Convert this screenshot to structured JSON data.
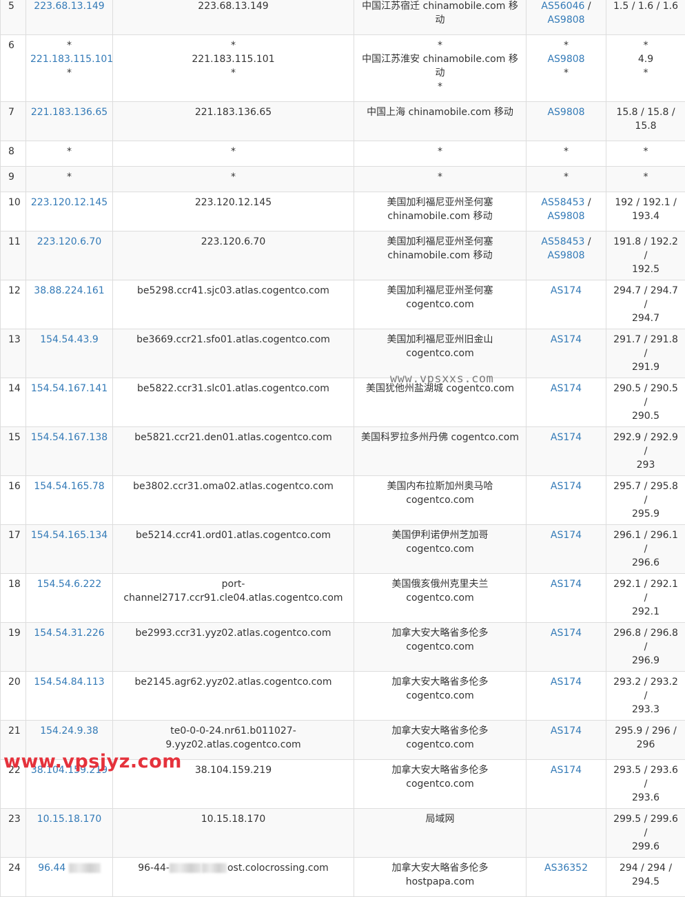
{
  "rows": [
    {
      "hop": "5",
      "ip": "223.68.13.149",
      "host": [
        "223.68.13.149"
      ],
      "loc": [
        "中国江苏宿迁 chinamobile.com 移",
        "动"
      ],
      "asn": [
        [
          "AS56046",
          " /"
        ],
        [
          "AS9808",
          ""
        ]
      ],
      "rtt": [
        "1.5 / 1.6 / 1.6"
      ]
    },
    {
      "hop": "6",
      "ip": [
        "*",
        "221.183.115.101",
        "*"
      ],
      "host": [
        "*",
        "221.183.115.101",
        "*"
      ],
      "loc": [
        "*",
        "中国江苏淮安 chinamobile.com 移",
        "动",
        "*"
      ],
      "asn": [
        [
          "*",
          ""
        ],
        [
          "AS9808",
          ""
        ],
        [
          "*",
          ""
        ]
      ],
      "rtt": [
        "*",
        "4.9",
        "*"
      ]
    },
    {
      "hop": "7",
      "ip": "221.183.136.65",
      "host": [
        "221.183.136.65"
      ],
      "loc": [
        "中国上海 chinamobile.com 移动"
      ],
      "asn": [
        [
          "AS9808",
          ""
        ]
      ],
      "rtt": [
        "15.8 / 15.8 /",
        "15.8"
      ]
    },
    {
      "hop": "8",
      "ip": "*",
      "host": [
        "*"
      ],
      "loc": [
        "*"
      ],
      "asn": [
        [
          "*",
          ""
        ]
      ],
      "rtt": [
        "*"
      ]
    },
    {
      "hop": "9",
      "ip": "*",
      "host": [
        "*"
      ],
      "loc": [
        "*"
      ],
      "asn": [
        [
          "*",
          ""
        ]
      ],
      "rtt": [
        "*"
      ]
    },
    {
      "hop": "10",
      "ip": "223.120.12.145",
      "host": [
        "223.120.12.145"
      ],
      "loc": [
        "美国加利福尼亚州圣何塞",
        "chinamobile.com 移动"
      ],
      "asn": [
        [
          "AS58453",
          " /"
        ],
        [
          "AS9808",
          ""
        ]
      ],
      "rtt": [
        "192 / 192.1 /",
        "193.4"
      ]
    },
    {
      "hop": "11",
      "ip": "223.120.6.70",
      "host": [
        "223.120.6.70"
      ],
      "loc": [
        "美国加利福尼亚州圣何塞",
        "chinamobile.com 移动"
      ],
      "asn": [
        [
          "AS58453",
          " /"
        ],
        [
          "AS9808",
          ""
        ]
      ],
      "rtt": [
        "191.8 / 192.2 /",
        "192.5"
      ]
    },
    {
      "hop": "12",
      "ip": "38.88.224.161",
      "host": [
        "be5298.ccr41.sjc03.atlas.cogentco.com"
      ],
      "loc": [
        "美国加利福尼亚州圣何塞",
        "cogentco.com"
      ],
      "asn": [
        [
          "AS174",
          ""
        ]
      ],
      "rtt": [
        "294.7 / 294.7 /",
        "294.7"
      ]
    },
    {
      "hop": "13",
      "ip": "154.54.43.9",
      "host": [
        "be3669.ccr21.sfo01.atlas.cogentco.com"
      ],
      "loc": [
        "美国加利福尼亚州旧金山",
        "cogentco.com"
      ],
      "asn": [
        [
          "AS174",
          ""
        ]
      ],
      "rtt": [
        "291.7 / 291.8 /",
        "291.9"
      ]
    },
    {
      "hop": "14",
      "ip": "154.54.167.141",
      "host": [
        "be5822.ccr31.slc01.atlas.cogentco.com"
      ],
      "loc": [
        "美国犹他州盐湖城 cogentco.com"
      ],
      "asn": [
        [
          "AS174",
          ""
        ]
      ],
      "rtt": [
        "290.5 / 290.5 /",
        "290.5"
      ]
    },
    {
      "hop": "15",
      "ip": "154.54.167.138",
      "host": [
        "be5821.ccr21.den01.atlas.cogentco.com"
      ],
      "loc": [
        "美国科罗拉多州丹佛 cogentco.com"
      ],
      "asn": [
        [
          "AS174",
          ""
        ]
      ],
      "rtt": [
        "292.9 / 292.9 /",
        "293"
      ]
    },
    {
      "hop": "16",
      "ip": "154.54.165.78",
      "host": [
        "be3802.ccr31.oma02.atlas.cogentco.com"
      ],
      "loc": [
        "美国内布拉斯加州奥马哈",
        "cogentco.com"
      ],
      "asn": [
        [
          "AS174",
          ""
        ]
      ],
      "rtt": [
        "295.7 / 295.8 /",
        "295.9"
      ]
    },
    {
      "hop": "17",
      "ip": "154.54.165.134",
      "host": [
        "be5214.ccr41.ord01.atlas.cogentco.com"
      ],
      "loc": [
        "美国伊利诺伊州芝加哥",
        "cogentco.com"
      ],
      "asn": [
        [
          "AS174",
          ""
        ]
      ],
      "rtt": [
        "296.1 / 296.1 /",
        "296.6"
      ]
    },
    {
      "hop": "18",
      "ip": "154.54.6.222",
      "host": [
        "port-channel2717.ccr91.cle04.atlas.cogentco.com"
      ],
      "loc": [
        "美国俄亥俄州克里夫兰",
        "cogentco.com"
      ],
      "asn": [
        [
          "AS174",
          ""
        ]
      ],
      "rtt": [
        "292.1 / 292.1 /",
        "292.1"
      ]
    },
    {
      "hop": "19",
      "ip": "154.54.31.226",
      "host": [
        "be2993.ccr31.yyz02.atlas.cogentco.com"
      ],
      "loc": [
        "加拿大安大略省多伦多",
        "cogentco.com"
      ],
      "asn": [
        [
          "AS174",
          ""
        ]
      ],
      "rtt": [
        "296.8 / 296.8 /",
        "296.9"
      ]
    },
    {
      "hop": "20",
      "ip": "154.54.84.113",
      "host": [
        "be2145.agr62.yyz02.atlas.cogentco.com"
      ],
      "loc": [
        "加拿大安大略省多伦多",
        "cogentco.com"
      ],
      "asn": [
        [
          "AS174",
          ""
        ]
      ],
      "rtt": [
        "293.2 / 293.2 /",
        "293.3"
      ]
    },
    {
      "hop": "21",
      "ip": "154.24.9.38",
      "host": [
        "te0-0-0-24.nr61.b011027-",
        "9.yyz02.atlas.cogentco.com"
      ],
      "loc": [
        "加拿大安大略省多伦多",
        "cogentco.com"
      ],
      "asn": [
        [
          "AS174",
          ""
        ]
      ],
      "rtt": [
        "295.9 / 296 /",
        "296"
      ]
    },
    {
      "hop": "22",
      "ip": "38.104.159.219",
      "host": [
        "38.104.159.219"
      ],
      "loc": [
        "加拿大安大略省多伦多",
        "cogentco.com"
      ],
      "asn": [
        [
          "AS174",
          ""
        ]
      ],
      "rtt": [
        "293.5 / 293.6 /",
        "293.6"
      ]
    },
    {
      "hop": "23",
      "ip": "10.15.18.170",
      "host": [
        "10.15.18.170"
      ],
      "loc": [
        "局域网"
      ],
      "asn": [],
      "rtt": [
        "299.5 / 299.6 /",
        "299.6"
      ]
    },
    {
      "hop": "24",
      "ip": "96.44",
      "ip_blurred": true,
      "host": [
        "96-44-"
      ],
      "host_tail": "ost.colocrossing.com",
      "host_blurred": true,
      "loc": [
        "加拿大安大略省多伦多",
        "hostpapa.com"
      ],
      "asn": [
        [
          "AS36352",
          ""
        ]
      ],
      "rtt": [
        "294 / 294 /",
        "294.5"
      ]
    }
  ],
  "watermarks": {
    "center": "www.vpsxxs.com",
    "corner": "www.vpsjyz.com"
  },
  "colors": {
    "link": "#337ab7",
    "stripe": "#f9f9f9",
    "border": "#dddddd",
    "watermark_corner": "#e5323c"
  }
}
